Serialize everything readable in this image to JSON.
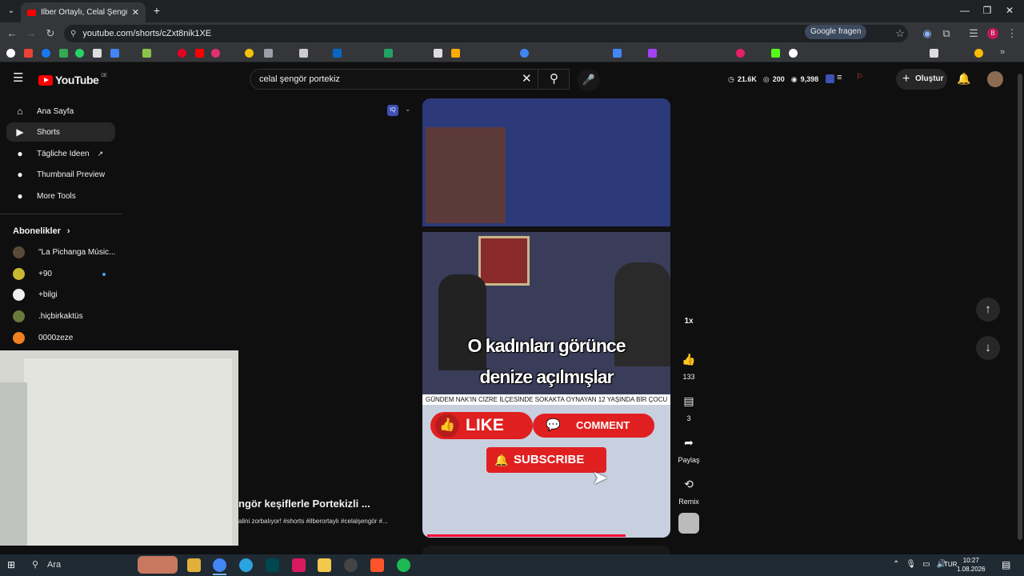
{
  "browser": {
    "tab_title": "İlber Ortaylı, Celal Şengör keşifl",
    "url": "youtube.com/shorts/cZxt8nik1XE",
    "translate_label": "Google fragen"
  },
  "youtube": {
    "logo_text": "YouTube",
    "logo_region": "DE",
    "search_value": "celal şengör portekiz",
    "stats": {
      "a": "21.6K",
      "b": "200",
      "c": "9,398"
    },
    "create_label": "Oluştur"
  },
  "sidebar": {
    "items": [
      {
        "label": "Ana Sayfa",
        "icon": "home-icon"
      },
      {
        "label": "Shorts",
        "icon": "shorts-icon"
      },
      {
        "label": "Tägliche Ideen",
        "icon": "ideas-icon"
      },
      {
        "label": "Thumbnail Preview",
        "icon": "preview-icon"
      },
      {
        "label": "More Tools",
        "icon": "tools-icon"
      }
    ],
    "subscriptions_label": "Abonelikler",
    "subscriptions": [
      {
        "label": "\"La Pichanga Músic...",
        "color": "#5a4a3a"
      },
      {
        "label": "+90",
        "color": "#c8b830"
      },
      {
        "label": "+bilgi",
        "color": "#f0f0f0"
      },
      {
        "label": ".hiçbirkaktüs",
        "color": "#6a7a3a"
      },
      {
        "label": "0000zeze",
        "color": "#f08020"
      }
    ]
  },
  "short": {
    "caption_line1": "O kadınları görünce",
    "caption_line2": "denize açılmışlar",
    "ticker": "GÜNDEM NAK'IN CİZRE İLÇESİNDE SOKAKTA OYNAYAN 12 YAŞINDA BİR ÇOCU",
    "like_overlay": "LIKE",
    "comment_overlay": "COMMENT",
    "subscribe_overlay": "SUBSCRIBE",
    "title_partial": "ngör keşiflerle Portekizli ...",
    "tags_partial": "alini zorbalıyor! #shorts #ilberortaylı #celalşengör #...",
    "progress": 0.8
  },
  "actions": {
    "speed": "1x",
    "likes": "133",
    "comments": "3",
    "share": "Paylaş",
    "remix": "Remix"
  },
  "taskbar": {
    "search": "Ara",
    "lang": "TUR",
    "time": "10:27",
    "date": "1.08.2026"
  }
}
